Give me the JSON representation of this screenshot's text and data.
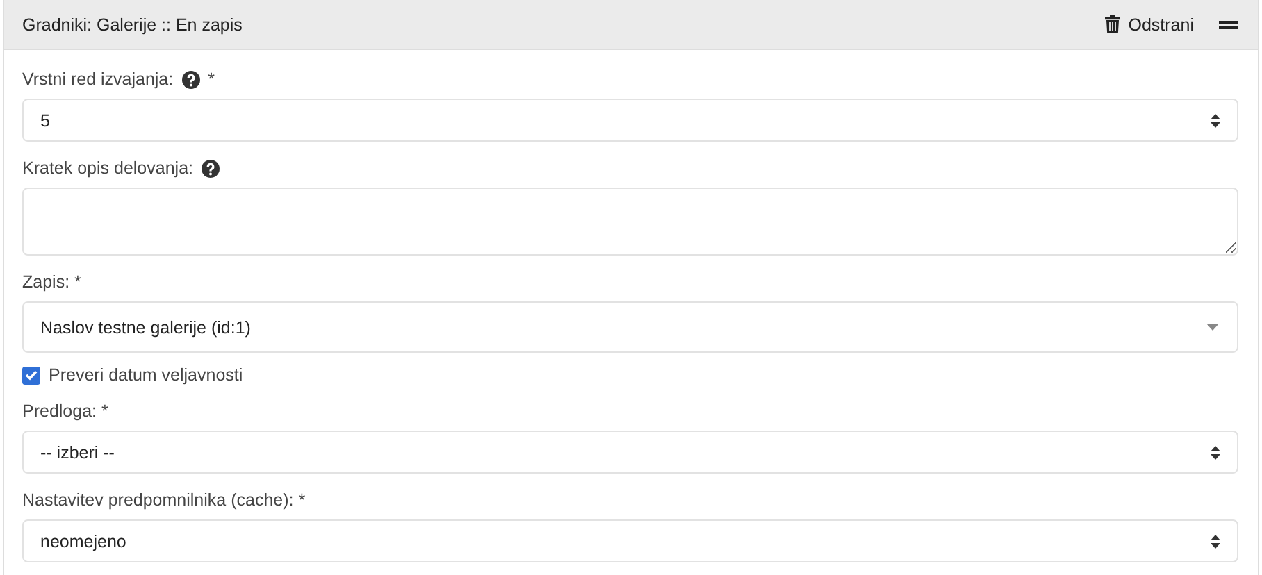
{
  "panel": {
    "title": "Gradniki: Galerije :: En zapis",
    "remove_button": "Odstrani"
  },
  "fields": [
    {
      "kind": "select",
      "label": "Vrstni red izvajanja:",
      "help": true,
      "required": "*",
      "value": "5"
    },
    {
      "kind": "textarea",
      "label": "Kratek opis delovanja:",
      "help": true
    },
    {
      "kind": "combo",
      "label": "Zapis: *",
      "value": "Naslov testne galerije (id:1)"
    },
    {
      "kind": "checkbox",
      "label": "Preveri datum veljavnosti",
      "checked": true
    },
    {
      "kind": "select",
      "label": "Predloga: *",
      "value": "-- izberi --"
    },
    {
      "kind": "select",
      "label": "Nastavitev predpomnilnika (cache): *",
      "value": "neomejeno"
    }
  ]
}
